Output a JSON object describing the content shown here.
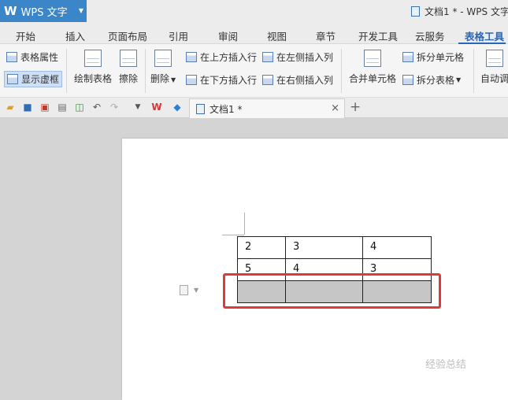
{
  "app": {
    "logo": "W",
    "name": "WPS 文字",
    "window_title": "文档1 * - WPS 文字"
  },
  "menu": {
    "tabs": [
      "开始",
      "插入",
      "页面布局",
      "引用",
      "审阅",
      "视图",
      "章节",
      "开发工具",
      "云服务",
      "表格工具"
    ],
    "active": "表格工具"
  },
  "ribbon": {
    "table_props": "表格属性",
    "show_gridlines": "显示虚框",
    "draw_table": "绘制表格",
    "erase": "擦除",
    "delete": "删除",
    "insert_above": "在上方插入行",
    "insert_below": "在下方插入行",
    "insert_left": "在左侧插入列",
    "insert_right": "在右侧插入列",
    "merge_cells": "合并单元格",
    "split_cells": "拆分单元格",
    "split_table": "拆分表格",
    "auto_fit": "自动调"
  },
  "tabs": {
    "doc_name": "文档1 *",
    "close": "×",
    "new": "+"
  },
  "table": {
    "rows": [
      [
        "2",
        "3",
        "4"
      ],
      [
        "5",
        "4",
        "3"
      ],
      [
        "",
        "",
        ""
      ]
    ]
  },
  "watermark": "经验总结",
  "colors": {
    "accent": "#2b67b8",
    "highlight": "#e0393c",
    "selected_row": "#c6c6c6"
  }
}
